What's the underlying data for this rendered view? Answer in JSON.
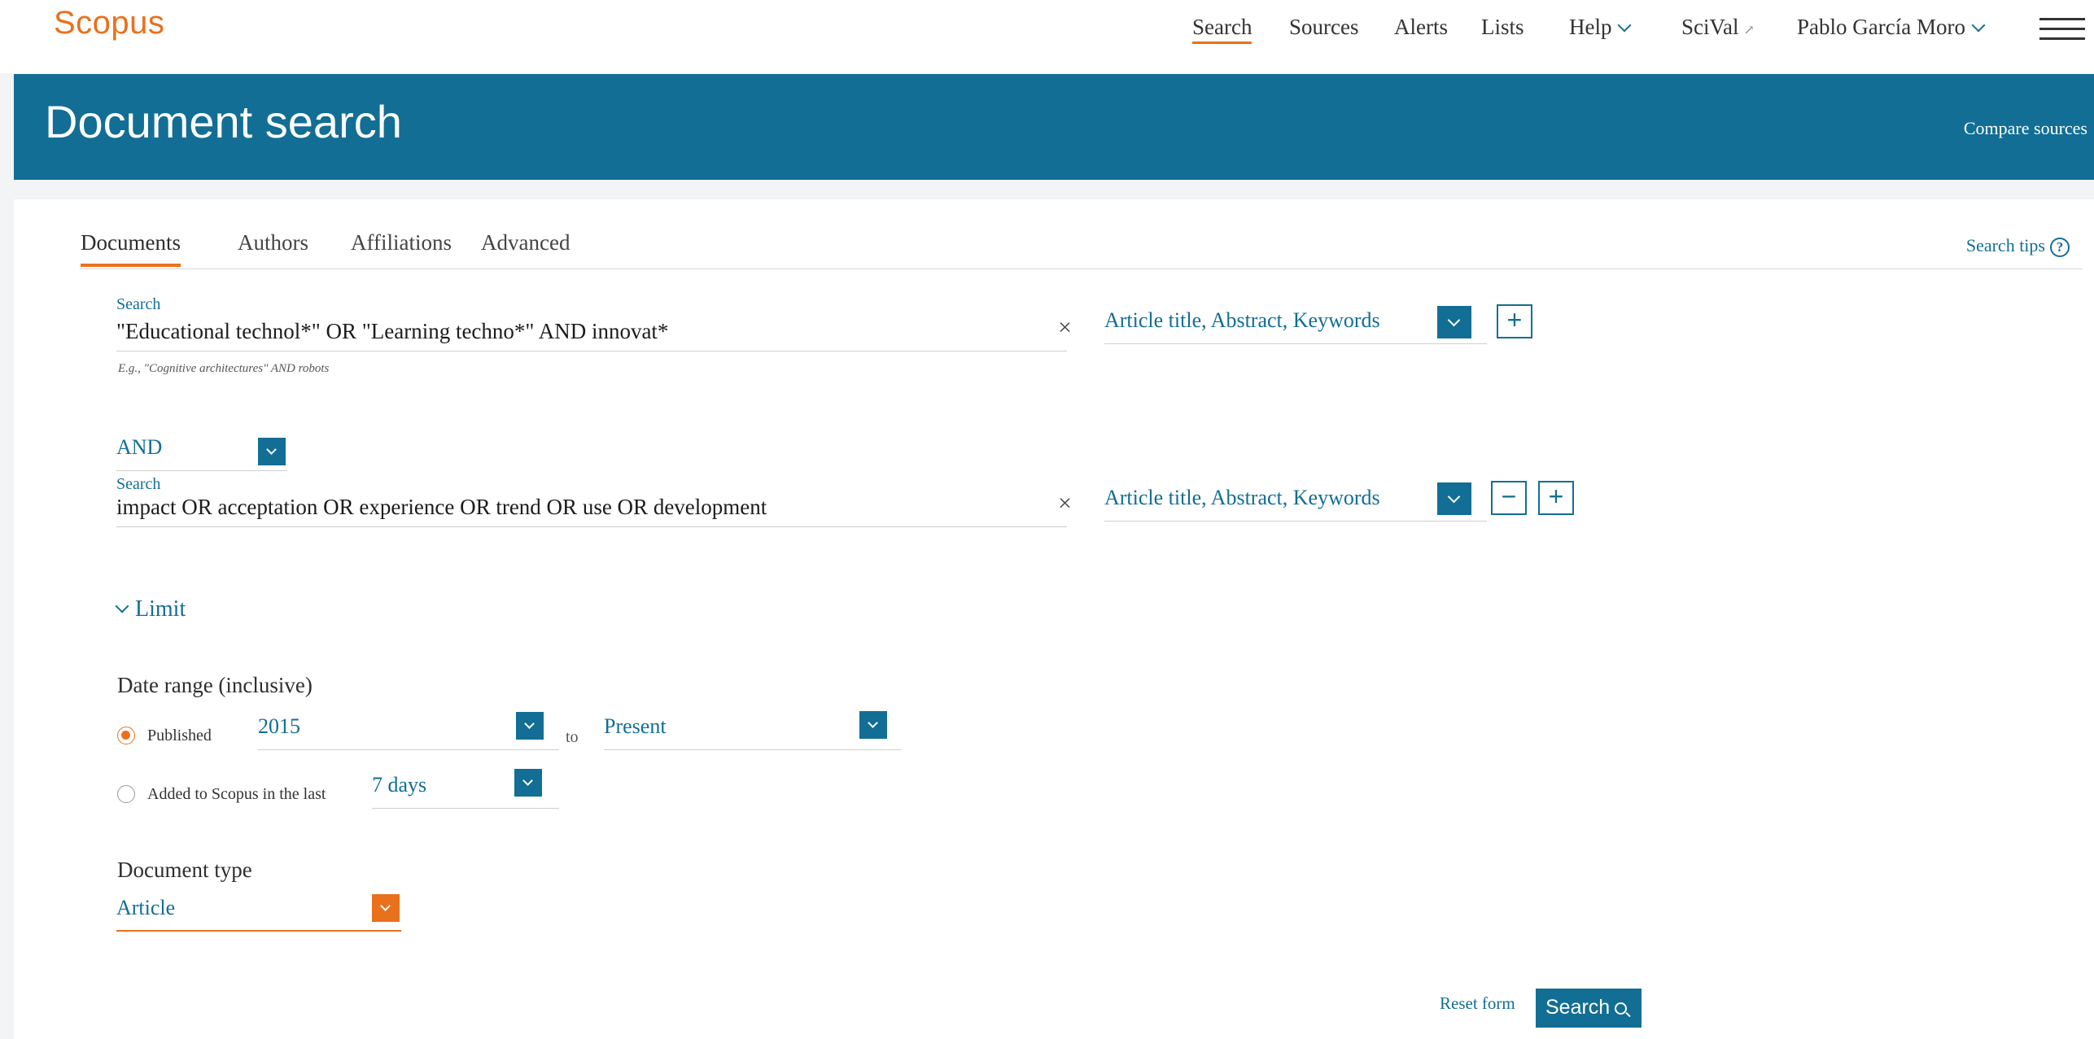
{
  "app": {
    "logo": "Scopus"
  },
  "nav": {
    "search": "Search",
    "sources": "Sources",
    "alerts": "Alerts",
    "lists": "Lists",
    "help": "Help",
    "scival": "SciVal",
    "user": "Pablo García Moro"
  },
  "header": {
    "title": "Document search",
    "compare": "Compare sources"
  },
  "tabs": [
    "Documents",
    "Authors",
    "Affiliations",
    "Advanced"
  ],
  "search_tips": "Search tips",
  "search1": {
    "label": "Search",
    "value": "\"Educational technol*\"  OR \"Learning techno*\" AND innovat*",
    "example": "E.g., \"Cognitive architectures\" AND robots",
    "field": "Article title, Abstract, Keywords"
  },
  "operator": "AND",
  "search2": {
    "label": "Search",
    "value": "impact  OR  acceptation  OR  experience  OR  trend  OR  use  OR  development",
    "field": "Article title, Abstract, Keywords"
  },
  "limit": {
    "label": "Limit"
  },
  "date_range": {
    "heading": "Date range (inclusive)",
    "published_label": "Published",
    "from": "2015",
    "to_label": "to",
    "to": "Present",
    "added_label": "Added to Scopus in the last",
    "added_value": "7 days"
  },
  "doc_type": {
    "heading": "Document type",
    "value": "Article"
  },
  "actions": {
    "reset": "Reset form",
    "search": "Search"
  },
  "colors": {
    "accent": "#e9711c",
    "primary": "#126e94"
  }
}
